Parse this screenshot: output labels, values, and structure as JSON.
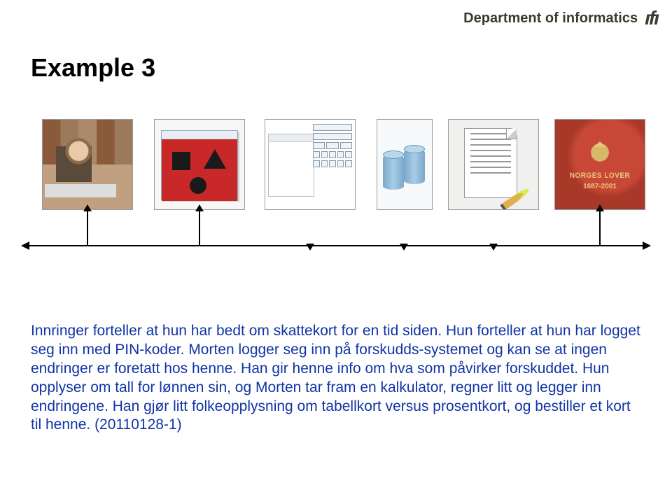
{
  "header": {
    "department": "Department of informatics",
    "logo_text": "ıfı"
  },
  "title": "Example 3",
  "book": {
    "title": "NORGES LOVER",
    "years": "1687-2001"
  },
  "paragraph": "Innringer forteller at hun har bedt om skattekort for en tid siden. Hun forteller at hun har logget seg inn med PIN-koder. Morten logger seg inn på forskudds-systemet og kan se at ingen endringer er foretatt hos henne. Han gir henne info om hva som påvirker forskuddet. Hun opplyser om tall for lønnen sin, og Morten tar fram en kalkulator, regner litt og legger inn endringene. Han gjør litt folkeopplysning om tabellkort versus prosentkort, og bestiller et kort til henne. (20110128-1)"
}
